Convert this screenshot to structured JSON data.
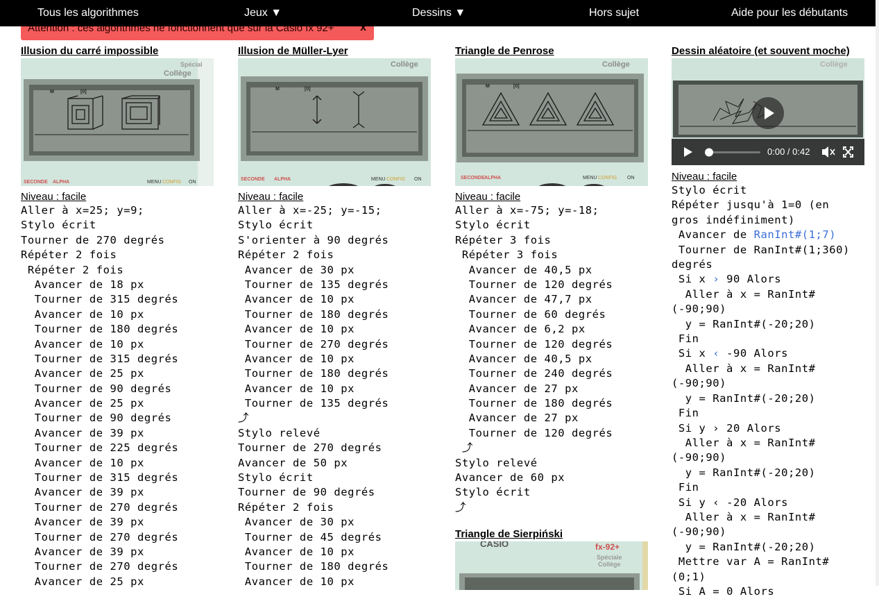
{
  "nav": {
    "items": [
      "Tous les algorithmes",
      "Jeux ▼",
      "Dessins ▼",
      "Hors sujet",
      "Aide pour les débutants"
    ]
  },
  "warning": {
    "text": "Attention : ces algorithmes ne fonctionnent que sur la Casio fx 92+",
    "close": "x",
    "color": "#f55a5a"
  },
  "columns": [
    {
      "title": "Illusion du carré impossible",
      "level": "Niveau : facile",
      "photo_labels": {
        "brand_top": "Spécial",
        "brand": "Collège",
        "m": "M",
        "zero": "[0]",
        "seconde": "SECONDE",
        "alpha": "ALPHA",
        "menu": "MENU",
        "config": "CONFIG",
        "on": "ON"
      },
      "code": [
        "Aller à x=25; y=9;",
        "Stylo écrit",
        "Tourner de 270 degrés",
        "Répéter 2 fois",
        " Répéter 2 fois",
        "  Avancer de 18 px",
        "  Tourner de 315 degrés",
        "  Avancer de 10 px",
        "  Tourner de 180 degrés",
        "  Avancer de 10 px",
        "  Tourner de 315 degrés",
        "  Avancer de 25 px",
        "  Tourner de 90 degrés",
        "  Avancer de 25 px",
        "  Tourner de 90 degrés",
        "  Avancer de 39 px",
        "  Tourner de 225 degrés",
        "  Avancer de 10 px",
        "  Tourner de 315 degrés",
        "  Avancer de 39 px",
        "  Tourner de 270 degrés",
        "  Avancer de 39 px",
        "  Tourner de 270 degrés",
        "  Avancer de 39 px",
        "  Tourner de 270 degrés",
        "  Avancer de 25 px"
      ]
    },
    {
      "title": "Illusion de Müller-Lyer",
      "level": "Niveau : facile",
      "photo_labels": {
        "brand": "Collège",
        "m": "M",
        "zero": "[0]",
        "seconde": "SECONDE",
        "alpha": "ALPHA",
        "menu": "MENU",
        "config": "CONFIG",
        "on": "ON"
      },
      "code": [
        "Aller à x=-25; y=-15;",
        "Stylo écrit",
        "S'orienter à 90 degrés",
        "Répéter 2 fois",
        " Avancer de 30 px",
        " Tourner de 135 degrés",
        " Avancer de 10 px",
        " Tourner de 180 degrés",
        " Avancer de 10 px",
        " Tourner de 270 degrés",
        " Avancer de 10 px",
        " Tourner de 180 degrés",
        " Avancer de 10 px",
        " Tourner de 135 degrés",
        "⤴",
        "Stylo relevé",
        "Tourner de 270 degrés",
        "Avancer de 50 px",
        "Stylo écrit",
        "Tourner de 90 degrés",
        "Répéter 2 fois",
        " Avancer de 30 px",
        " Tourner de 45 degrés",
        " Avancer de 10 px",
        " Tourner de 180 degrés",
        " Avancer de 10 px"
      ]
    },
    {
      "title": "Triangle de Penrose",
      "level": "Niveau : facile",
      "photo_labels": {
        "brand": "Collège",
        "m": "M",
        "zero": "[0]",
        "seconde": "SECONDE",
        "alpha": "ALPHA",
        "menu": "MENU",
        "config": "CONFIG",
        "on": "ON"
      },
      "code": [
        "Aller à x=-75; y=-18;",
        "Stylo écrit",
        "Répéter 3 fois",
        " Répéter 3 fois",
        "  Avancer de 40,5 px",
        "  Tourner de 120 degrés",
        "  Avancer de 47,7 px",
        "  Tourner de 60 degrés",
        "  Avancer de 6,2 px",
        "  Tourner de 120 degrés",
        "  Avancer de 40,5 px",
        "  Tourner de 240 degrés",
        "  Avancer de 27 px",
        "  Tourner de 180 degrés",
        "  Avancer de 27 px",
        "  Tourner de 120 degrés",
        " ⤴",
        "Stylo relevé",
        "Avancer de 60 px",
        "Stylo écrit",
        "⤴"
      ],
      "second_title": "Triangle de Sierpiński",
      "second_photo_labels": {
        "brand_logo": "CASIO",
        "model": "fx-92+",
        "special": "Spéciale",
        "college": "Collège"
      }
    },
    {
      "title": "Dessin aléatoire (et souvent moche)",
      "level": "Niveau : facile",
      "photo_labels": {
        "brand": "Collège"
      },
      "video": {
        "time": "0:00 / 0:42",
        "progress": 0
      },
      "code": [
        [
          "Stylo écrit"
        ],
        [
          "Répéter jusqu'à 1=0 (en gros indéfiniment)"
        ],
        [
          " Avancer de ",
          {
            "op": "RanInt#(1;7)"
          }
        ],
        [
          " Tourner de RanInt#(1;360) degrés"
        ],
        [
          " Si x ",
          {
            "op": "›"
          },
          " 90 Alors"
        ],
        [
          "  Aller à x = RanInt#(-90;90)"
        ],
        [
          "  y = RanInt#(-20;20)"
        ],
        [
          " Fin"
        ],
        [
          " Si x ",
          {
            "op": "‹"
          },
          " -90 Alors"
        ],
        [
          "  Aller à x = RanInt#(-90;90)"
        ],
        [
          "  y = RanInt#(-20;20)"
        ],
        [
          " Fin"
        ],
        [
          " Si y › 20 Alors"
        ],
        [
          "  Aller à x = RanInt#(-90;90)"
        ],
        [
          "  y = RanInt#(-20;20)"
        ],
        [
          " Fin"
        ],
        [
          " Si y ‹ -20 Alors"
        ],
        [
          "  Aller à x = RanInt#(-90;90)"
        ],
        [
          "  y = RanInt#(-20;20)"
        ],
        [
          " Mettre var A = RanInt#(0;1)"
        ],
        [
          " Si A = 0 Alors"
        ]
      ]
    }
  ]
}
